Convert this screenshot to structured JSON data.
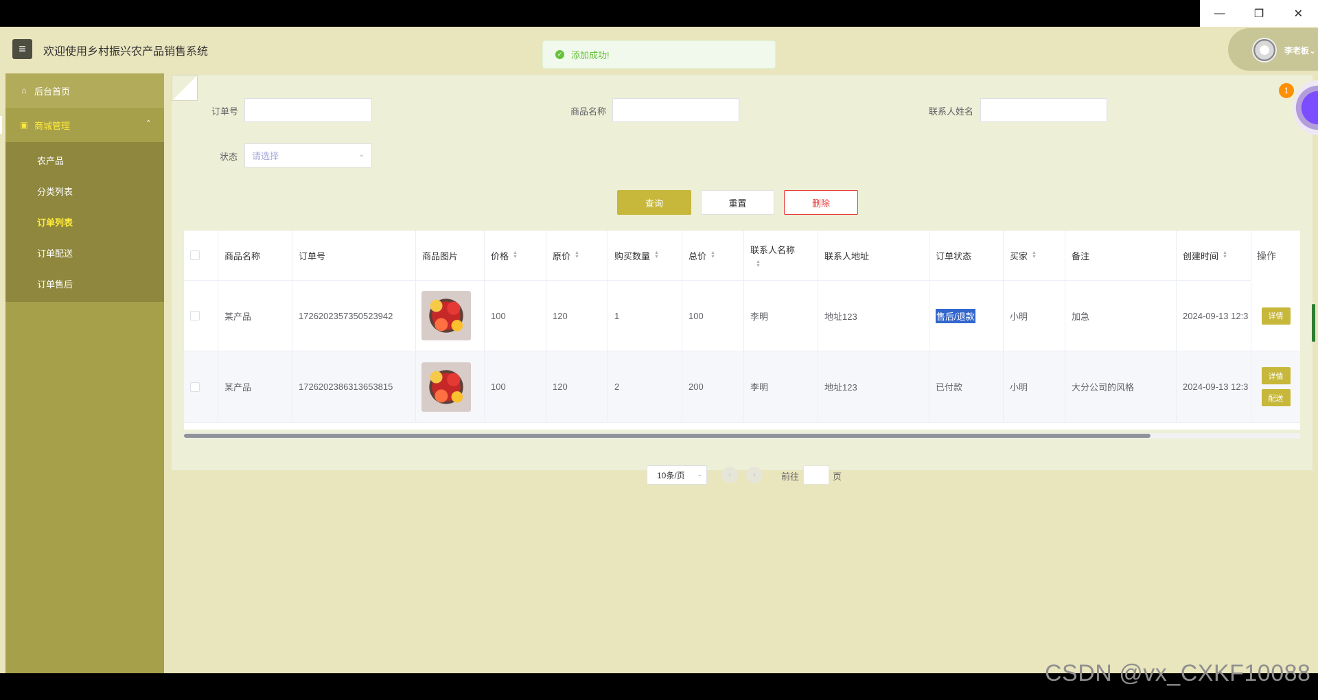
{
  "app": {
    "title": "欢迎使用乡村振兴农产品销售系统",
    "user_name": "李老板"
  },
  "toast": {
    "message": "添加成功!",
    "status_color": "#67c23a"
  },
  "window_controls": {
    "minimize": "—",
    "restore": "❐",
    "close": "✕"
  },
  "sidebar": {
    "home": "后台首页",
    "group": "商城管理",
    "items": [
      {
        "label": "农产品",
        "active": false
      },
      {
        "label": "分类列表",
        "active": false
      },
      {
        "label": "订单列表",
        "active": true
      },
      {
        "label": "订单配送",
        "active": false
      },
      {
        "label": "订单售后",
        "active": false
      }
    ]
  },
  "filters": {
    "order_no_label": "订单号",
    "product_name_label": "商品名称",
    "contact_name_label": "联系人姓名",
    "status_label": "状态",
    "status_placeholder": "请选择"
  },
  "actions": {
    "query": "查询",
    "reset": "重置",
    "delete": "删除"
  },
  "table": {
    "headers": {
      "product_name": "商品名称",
      "order_no": "订单号",
      "image": "商品图片",
      "price": "价格",
      "original_price": "原价",
      "quantity": "购买数量",
      "total": "总价",
      "contact_name": "联系人名称",
      "contact_address": "联系人地址",
      "status": "订单状态",
      "buyer": "买家",
      "remark": "备注",
      "created_at": "创建时间",
      "ops": "操作"
    },
    "rows": [
      {
        "product_name": "某产品",
        "order_no": "1726202357350523942",
        "price": "100",
        "original_price": "120",
        "quantity": "1",
        "total": "100",
        "contact_name": "李明",
        "contact_address": "地址123",
        "status": "售后/退款",
        "buyer": "小明",
        "remark": "加急",
        "created_at": "2024-09-13 12:3",
        "ops": [
          "详情"
        ]
      },
      {
        "product_name": "某产品",
        "order_no": "1726202386313653815",
        "price": "100",
        "original_price": "120",
        "quantity": "2",
        "total": "200",
        "contact_name": "李明",
        "contact_address": "地址123",
        "status": "已付款",
        "buyer": "小明",
        "remark": "大分公司的风格",
        "created_at": "2024-09-13 12:3",
        "ops": [
          "详情",
          "配送"
        ]
      }
    ]
  },
  "pagination": {
    "page_size": "10条/页",
    "goto_label": "前往",
    "goto_unit": "页",
    "prev": "‹",
    "next": "›"
  },
  "badge": {
    "count": "1"
  },
  "watermark": "CSDN @vx_CXKF10088",
  "colors": {
    "accent": "#c7b73a",
    "sidebar": "#a7a04b",
    "background": "#e9e5bd",
    "danger": "#e53935"
  }
}
